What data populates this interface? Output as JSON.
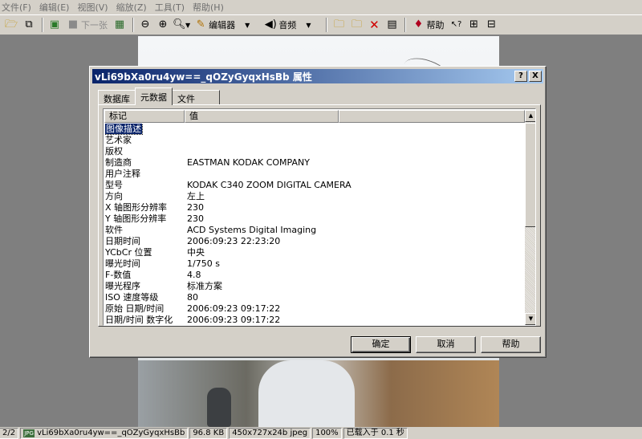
{
  "menu": [
    "文件(F)",
    "编辑(E)",
    "视图(V)",
    "缩放(Z)",
    "工具(T)",
    "帮助(H)"
  ],
  "toolbar": {
    "next_label": "下一张",
    "editor_label": "编辑器",
    "audio_label": "音频",
    "help_label": "帮助"
  },
  "dialog": {
    "title": "vLi69bXa0ru4yw==_qOZyGyqxHsBb 属性",
    "help_btn": "?",
    "close_btn": "X",
    "tabs": [
      "数据库",
      "元数据",
      "文件"
    ],
    "active_tab": 1,
    "columns": [
      "标记",
      "值"
    ],
    "rows": [
      {
        "k": "图像描述",
        "v": ""
      },
      {
        "k": "艺术家",
        "v": ""
      },
      {
        "k": "版权",
        "v": ""
      },
      {
        "k": "制造商",
        "v": "EASTMAN KODAK COMPANY"
      },
      {
        "k": "用户注释",
        "v": ""
      },
      {
        "k": "型号",
        "v": "KODAK C340 ZOOM DIGITAL CAMERA"
      },
      {
        "k": "方向",
        "v": "左上"
      },
      {
        "k": "X 轴图形分辨率",
        "v": "230"
      },
      {
        "k": "Y 轴图形分辨率",
        "v": "230"
      },
      {
        "k": "软件",
        "v": "ACD Systems Digital Imaging"
      },
      {
        "k": "日期时间",
        "v": "2006:09:23 22:23:20"
      },
      {
        "k": "YCbCr 位置",
        "v": "中央"
      },
      {
        "k": "曝光时间",
        "v": "1/750 s"
      },
      {
        "k": "F-数值",
        "v": "4.8"
      },
      {
        "k": "曝光程序",
        "v": "标准方案"
      },
      {
        "k": "ISO 速度等级",
        "v": "80"
      },
      {
        "k": "原始 日期/时间",
        "v": "2006:09:23 09:17:22"
      },
      {
        "k": "日期/时间 数字化",
        "v": "2006:09:23 09:17:22"
      }
    ],
    "ok": "确定",
    "cancel": "取消",
    "help": "帮助"
  },
  "status": {
    "index": "2/2",
    "filename": "vLi69bXa0ru4yw==_qOZyGyqxHsBb",
    "size": "96.8 KB",
    "dims": "450x727x24b jpeg",
    "zoom": "100%",
    "load": "已载入于 0.1 秒"
  }
}
